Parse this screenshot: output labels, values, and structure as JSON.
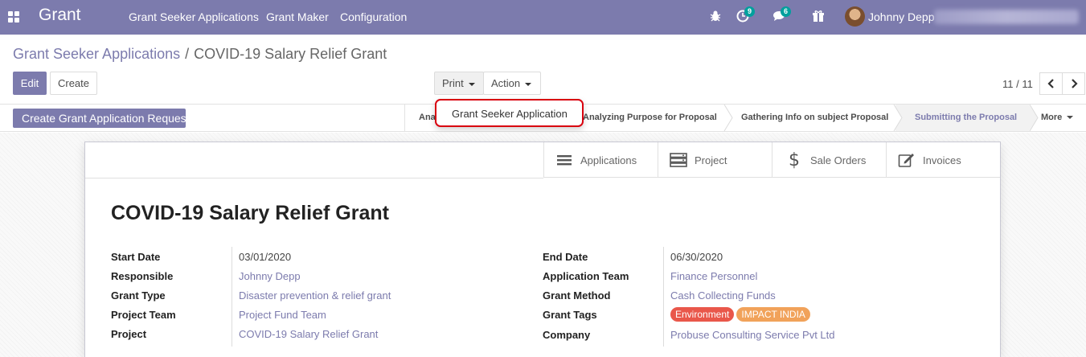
{
  "navbar": {
    "brand": "Grant",
    "menu": [
      "Grant Seeker Applications",
      "Grant Maker",
      "Configuration"
    ],
    "activity_count": "9",
    "messages_count": "6",
    "user_name": "Johnny Depp",
    "color": "#7c7bad"
  },
  "breadcrumb": {
    "parent": "Grant Seeker Applications",
    "separator": "/",
    "current": "COVID-19 Salary Relief Grant"
  },
  "toolbar": {
    "edit_label": "Edit",
    "create_label": "Create",
    "print_label": "Print",
    "action_label": "Action"
  },
  "pager": {
    "value": "11 / 11",
    "prev_icon": "chevron-left-icon",
    "next_icon": "chevron-right-icon"
  },
  "statusbar": {
    "action_button": "Create Grant Application Request",
    "stages": [
      {
        "label": "Ana",
        "active": false
      },
      {
        "label": "Analyzing Purpose for Proposal",
        "active": false
      },
      {
        "label": "Gathering Info on subject Proposal",
        "active": false
      },
      {
        "label": "Submitting the Proposal",
        "active": true
      }
    ],
    "more_label": "More"
  },
  "print_dropdown": {
    "items": [
      "Grant Seeker Application"
    ],
    "highlight_color": "#d9000f"
  },
  "smart_buttons": [
    {
      "label": "Applications",
      "icon": "list-icon"
    },
    {
      "label": "Project",
      "icon": "server-icon"
    },
    {
      "label": "Sale Orders",
      "icon": "dollar-icon"
    },
    {
      "label": "Invoices",
      "icon": "edit-icon"
    }
  ],
  "record": {
    "title": "COVID-19 Salary Relief Grant",
    "left_fields": [
      {
        "label": "Start Date",
        "value": "03/01/2020",
        "link": false
      },
      {
        "label": "Responsible",
        "value": "Johnny Depp",
        "link": true
      },
      {
        "label": "Grant Type",
        "value": "Disaster prevention & relief grant",
        "link": true
      },
      {
        "label": "Project Team",
        "value": "Project Fund Team",
        "link": true
      },
      {
        "label": "Project",
        "value": "COVID-19 Salary Relief Grant",
        "link": true
      }
    ],
    "right_fields": [
      {
        "label": "End Date",
        "value": "06/30/2020",
        "link": false
      },
      {
        "label": "Application Team",
        "value": "Finance Personnel",
        "link": true
      },
      {
        "label": "Grant Method",
        "value": "Cash Collecting Funds",
        "link": true
      },
      {
        "label": "Grant Tags",
        "value": null,
        "link": false
      },
      {
        "label": "Company",
        "value": "Probuse Consulting Service Pvt Ltd",
        "link": true
      }
    ],
    "tags": [
      {
        "label": "Environment",
        "color": "#e9574a"
      },
      {
        "label": "IMPACT INDIA",
        "color": "#f1a25a"
      }
    ]
  }
}
